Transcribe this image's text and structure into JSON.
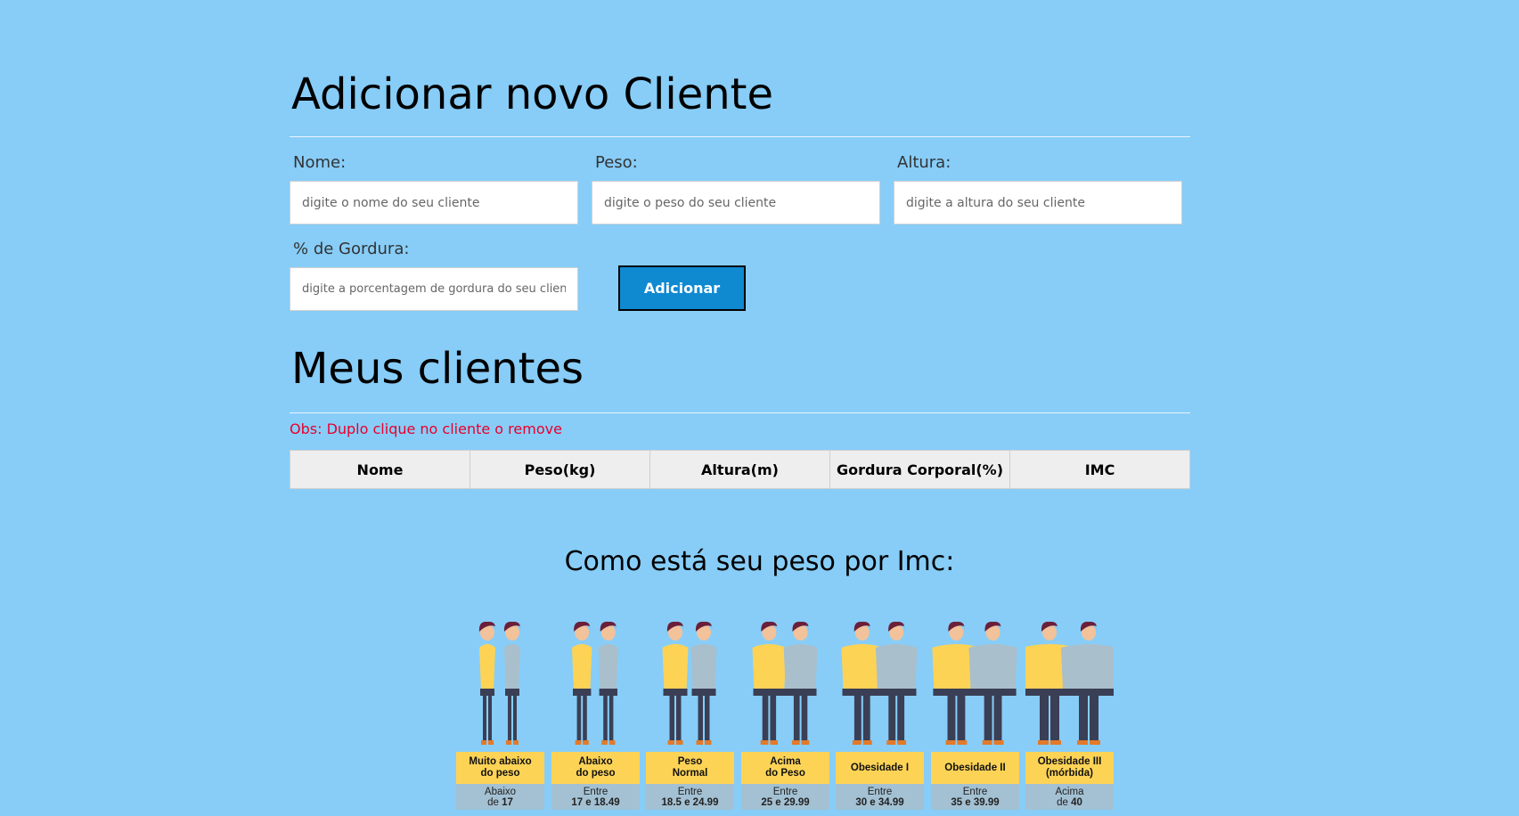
{
  "add_section": {
    "title": "Adicionar novo Cliente",
    "fields": {
      "nome": {
        "label": "Nome:",
        "placeholder": "digite o nome do seu cliente"
      },
      "peso": {
        "label": "Peso:",
        "placeholder": "digite o peso do seu cliente"
      },
      "altura": {
        "label": "Altura:",
        "placeholder": "digite a altura do seu cliente"
      },
      "gordura": {
        "label": "% de Gordura:",
        "placeholder": "digite a porcentagem de gordura do seu cliente"
      }
    },
    "submit_label": "Adicionar"
  },
  "clients_section": {
    "title": "Meus clientes",
    "note": "Obs: Duplo clique no cliente o remove",
    "columns": [
      "Nome",
      "Peso(kg)",
      "Altura(m)",
      "Gordura Corporal(%)",
      "IMC"
    ]
  },
  "imc_section": {
    "title": "Como está seu peso por Imc:",
    "categories": [
      {
        "name": "Muito abaixo\ndo peso",
        "range_line1": "Abaixo",
        "range_line2_pre": "de ",
        "range_line2_bold": "17",
        "figure_width": 0.0
      },
      {
        "name": "Abaixo\ndo peso",
        "range_line1": "Entre",
        "range_line2_pre": "",
        "range_line2_bold": "17 e 18.49",
        "figure_width": 0.1
      },
      {
        "name": "Peso\nNormal",
        "range_line1": "Entre",
        "range_line2_pre": "",
        "range_line2_bold": "18.5 e 24.99",
        "figure_width": 0.25
      },
      {
        "name": "Acima\ndo Peso",
        "range_line1": "Entre",
        "range_line2_pre": "",
        "range_line2_bold": "25 e 29.99",
        "figure_width": 0.45
      },
      {
        "name": "Obesidade I",
        "range_line1": "Entre",
        "range_line2_pre": "",
        "range_line2_bold": "30 e 34.99",
        "figure_width": 0.65
      },
      {
        "name": "Obesidade II",
        "range_line1": "Entre",
        "range_line2_pre": "",
        "range_line2_bold": "35 e 39.99",
        "figure_width": 0.82
      },
      {
        "name": "Obesidade III\n(mórbida)",
        "range_line1": "Acima",
        "range_line2_pre": "de ",
        "range_line2_bold": "40",
        "figure_width": 1.0
      }
    ],
    "colors": {
      "category_bg": "#fdd356",
      "range_bg": "#a3c1d3",
      "shirt_woman": "#fdd356",
      "shirt_man": "#a9bfcc",
      "pants": "#3a3f55",
      "hair": "#6a1f3a"
    }
  },
  "colors": {
    "page_bg": "#87cdf8",
    "button_bg": "#0f8ad1",
    "note_color": "#e8002b",
    "table_header_bg": "#eeeeee"
  }
}
